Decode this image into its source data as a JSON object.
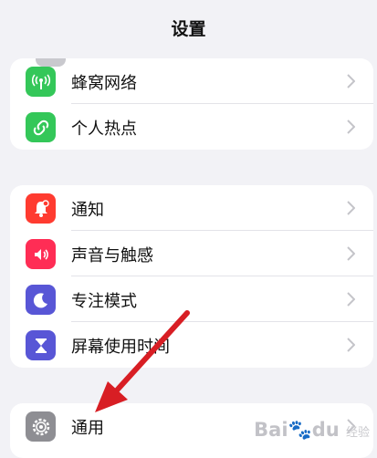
{
  "nav": {
    "title": "设置"
  },
  "groups": [
    {
      "items": [
        {
          "label": "蜂窝网络",
          "icon": "cellular-antenna-icon",
          "color": "#34c759"
        },
        {
          "label": "个人热点",
          "icon": "personal-hotspot-icon",
          "color": "#34c759"
        }
      ]
    },
    {
      "items": [
        {
          "label": "通知",
          "icon": "bell-icon",
          "color": "#ff3b30"
        },
        {
          "label": "声音与触感",
          "icon": "speaker-icon",
          "color": "#ff2d55"
        },
        {
          "label": "专注模式",
          "icon": "moon-icon",
          "color": "#5856d6"
        },
        {
          "label": "屏幕使用时间",
          "icon": "hourglass-icon",
          "color": "#5856d6"
        }
      ]
    },
    {
      "items": [
        {
          "label": "通用",
          "icon": "gear-icon",
          "color": "#8e8e93"
        }
      ]
    }
  ],
  "annotation": {
    "arrow_color": "#d81e24"
  },
  "watermark": {
    "brand": "Bai",
    "brand2": "du",
    "sub": "经验"
  }
}
